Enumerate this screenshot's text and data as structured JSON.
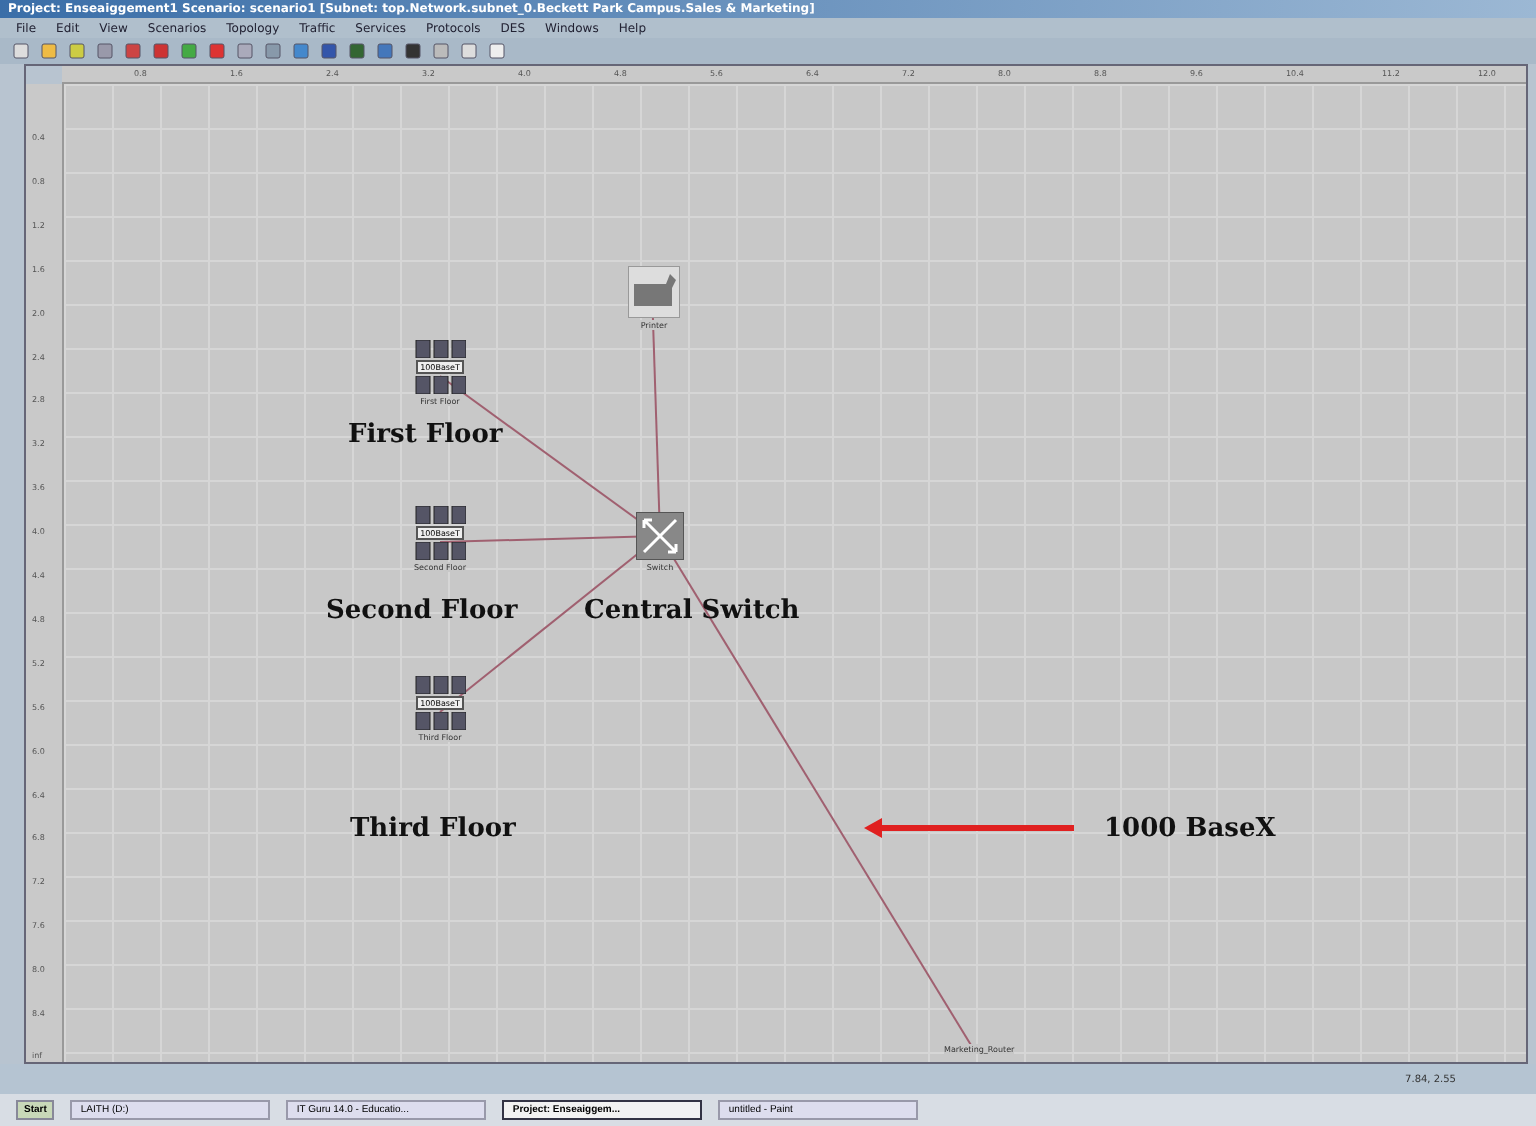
{
  "window": {
    "title": "Project: Enseaiggement1 Scenario: scenario1 [Subnet: top.Network.subnet_0.Beckett Park Campus.Sales & Marketing]"
  },
  "menu": [
    "File",
    "Edit",
    "View",
    "Scenarios",
    "Topology",
    "Traffic",
    "Services",
    "Protocols",
    "DES",
    "Windows",
    "Help"
  ],
  "ruler": {
    "x_ticks": [
      "0.8",
      "1.6",
      "2.4",
      "3.2",
      "4.0",
      "4.8",
      "5.6",
      "6.4",
      "7.2",
      "8.0",
      "8.8",
      "9.6",
      "10.4",
      "11.2",
      "12.0"
    ],
    "y_ticks": [
      "0.4",
      "0.8",
      "1.2",
      "1.6",
      "2.0",
      "2.4",
      "2.8",
      "3.2",
      "3.6",
      "4.0",
      "4.4",
      "4.8",
      "5.2",
      "5.6",
      "6.0",
      "6.4",
      "6.8",
      "7.2",
      "7.6",
      "8.0",
      "8.4"
    ],
    "corner": "inf"
  },
  "nodes": [
    {
      "kind": "lan",
      "badge": "100BaseT",
      "label": "First Floor"
    },
    {
      "kind": "lan",
      "badge": "100BaseT",
      "label": "Second Floor"
    },
    {
      "kind": "lan",
      "badge": "100BaseT",
      "label": "Third Floor"
    },
    {
      "kind": "printer",
      "label": "Printer"
    },
    {
      "kind": "switch",
      "label": "Switch"
    },
    {
      "kind": "router",
      "label": "Marketing_Router"
    }
  ],
  "annotations": [
    {
      "text": "First Floor"
    },
    {
      "text": "Second Floor"
    },
    {
      "text": "Central Switch"
    },
    {
      "text": "Third Floor"
    },
    {
      "text": "1000 BaseX"
    }
  ],
  "status": "7.84, 2.55",
  "taskbar": {
    "start": "Start",
    "items": [
      {
        "label": "LAITH (D:)",
        "selected": false
      },
      {
        "label": "IT Guru 14.0 - Educatio...",
        "selected": false
      },
      {
        "label": "Project: Enseaiggem...",
        "selected": true
      },
      {
        "label": "untitled - Paint",
        "selected": false
      }
    ]
  }
}
